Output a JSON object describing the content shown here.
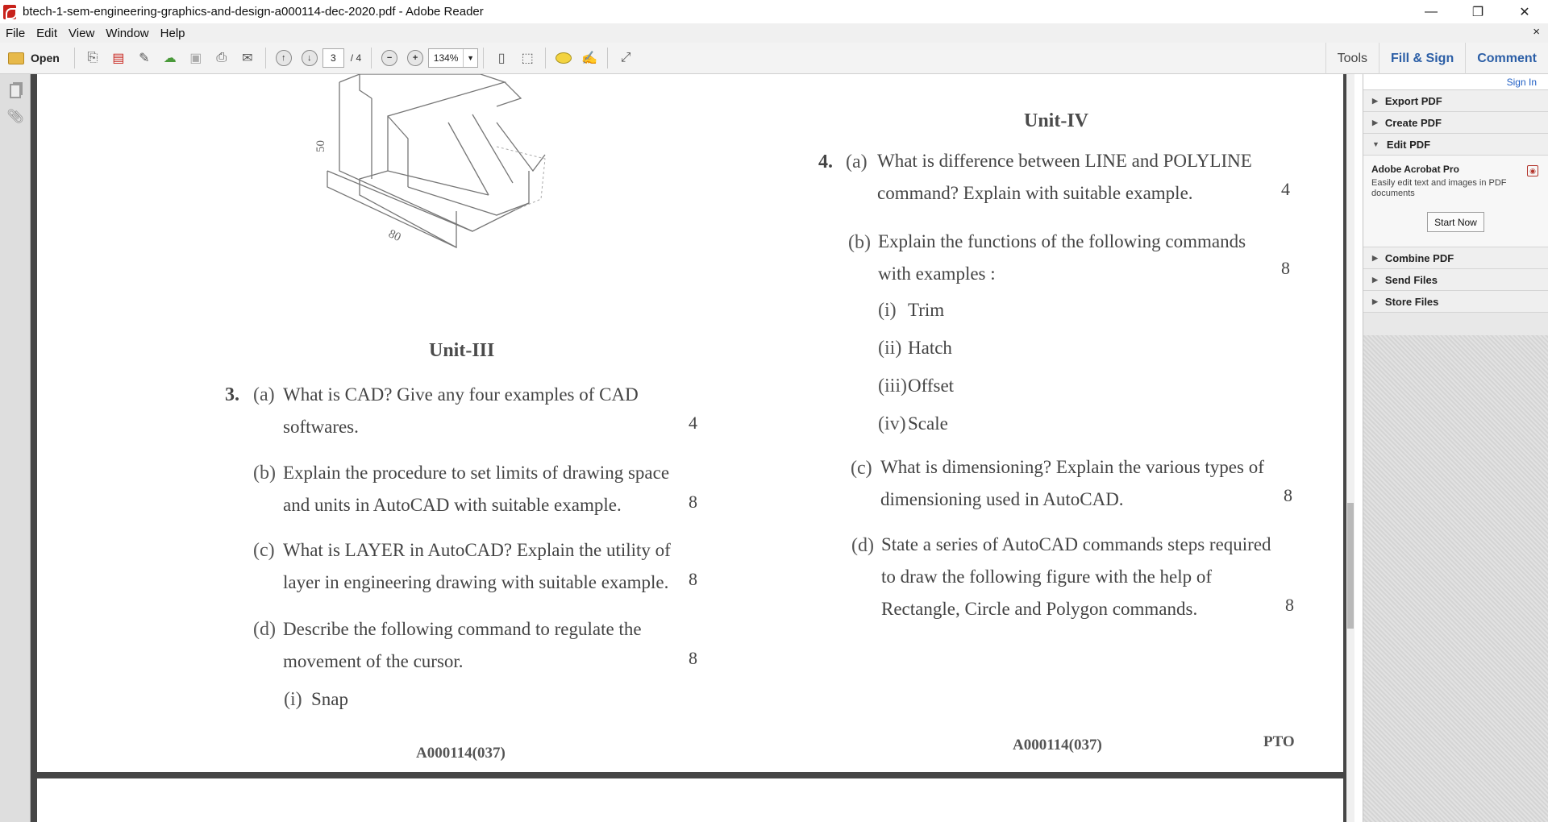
{
  "window": {
    "title": "btech-1-sem-engineering-graphics-and-design-a000114-dec-2020.pdf - Adobe Reader",
    "minimize_glyph": "—",
    "restore_glyph": "❐",
    "close_glyph": "✕"
  },
  "menu": {
    "file": "File",
    "edit": "Edit",
    "view": "View",
    "window": "Window",
    "help": "Help",
    "close_doc": "×"
  },
  "toolbar": {
    "open_label": "Open",
    "page_current": "3",
    "page_total": "/ 4",
    "zoom": "134%",
    "zoom_arrow": "▼",
    "tools": "Tools",
    "fill_sign": "Fill & Sign",
    "comment": "Comment"
  },
  "document": {
    "figure_label_50": "50",
    "figure_label_80": "80",
    "unit3": {
      "heading": "Unit-III",
      "number": "3.",
      "a_part": "(a)",
      "a_text_1": "What is CAD? Give any four examples of CAD",
      "a_text_2": "softwares.",
      "a_marks": "4",
      "b_part": "(b)",
      "b_text_1": "Explain the procedure to set limits of drawing space",
      "b_text_2": "and units in AutoCAD with suitable example.",
      "b_marks": "8",
      "c_part": "(c)",
      "c_text_1": "What is LAYER in AutoCAD? Explain the utility of",
      "c_text_2": "layer in engineering drawing with suitable example.",
      "c_marks": "8",
      "d_part": "(d)",
      "d_text_1": "Describe the following command to regulate the",
      "d_text_2": "movement of the cursor.",
      "d_marks": "8",
      "d_i_num": "(i)",
      "d_i": "Snap"
    },
    "unit4": {
      "heading": "Unit-IV",
      "number": "4.",
      "a_part": "(a)",
      "a_text_1": "What is difference between LINE and POLYLINE",
      "a_text_2": "command? Explain with suitable example.",
      "a_marks": "4",
      "b_part": "(b)",
      "b_text_1": "Explain the functions of the following commands",
      "b_text_2": "with examples :",
      "b_marks": "8",
      "b_i_num": "(i)",
      "b_i": "Trim",
      "b_ii_num": "(ii)",
      "b_ii": "Hatch",
      "b_iii_num": "(iii)",
      "b_iii": "Offset",
      "b_iv_num": "(iv)",
      "b_iv": "Scale",
      "c_part": "(c)",
      "c_text_1": "What is dimensioning? Explain the various types of",
      "c_text_2": "dimensioning used in AutoCAD.",
      "c_marks": "8",
      "d_part": "(d)",
      "d_text_1": "State a series of AutoCAD commands steps required",
      "d_text_2": "to draw the following figure with the help of",
      "d_text_3": "Rectangle, Circle and Polygon commands.",
      "d_marks": "8"
    },
    "footer_left": "A000114(037)",
    "footer_right": "A000114(037)",
    "pto": "PTO"
  },
  "right_panel": {
    "sign_in": "Sign In",
    "export_pdf": "Export PDF",
    "create_pdf": "Create PDF",
    "edit_pdf": "Edit PDF",
    "acrobat_title": "Adobe Acrobat Pro",
    "acrobat_desc": "Easily edit text and images in PDF documents",
    "start_now": "Start Now",
    "combine_pdf": "Combine PDF",
    "send_files": "Send Files",
    "store_files": "Store Files"
  }
}
